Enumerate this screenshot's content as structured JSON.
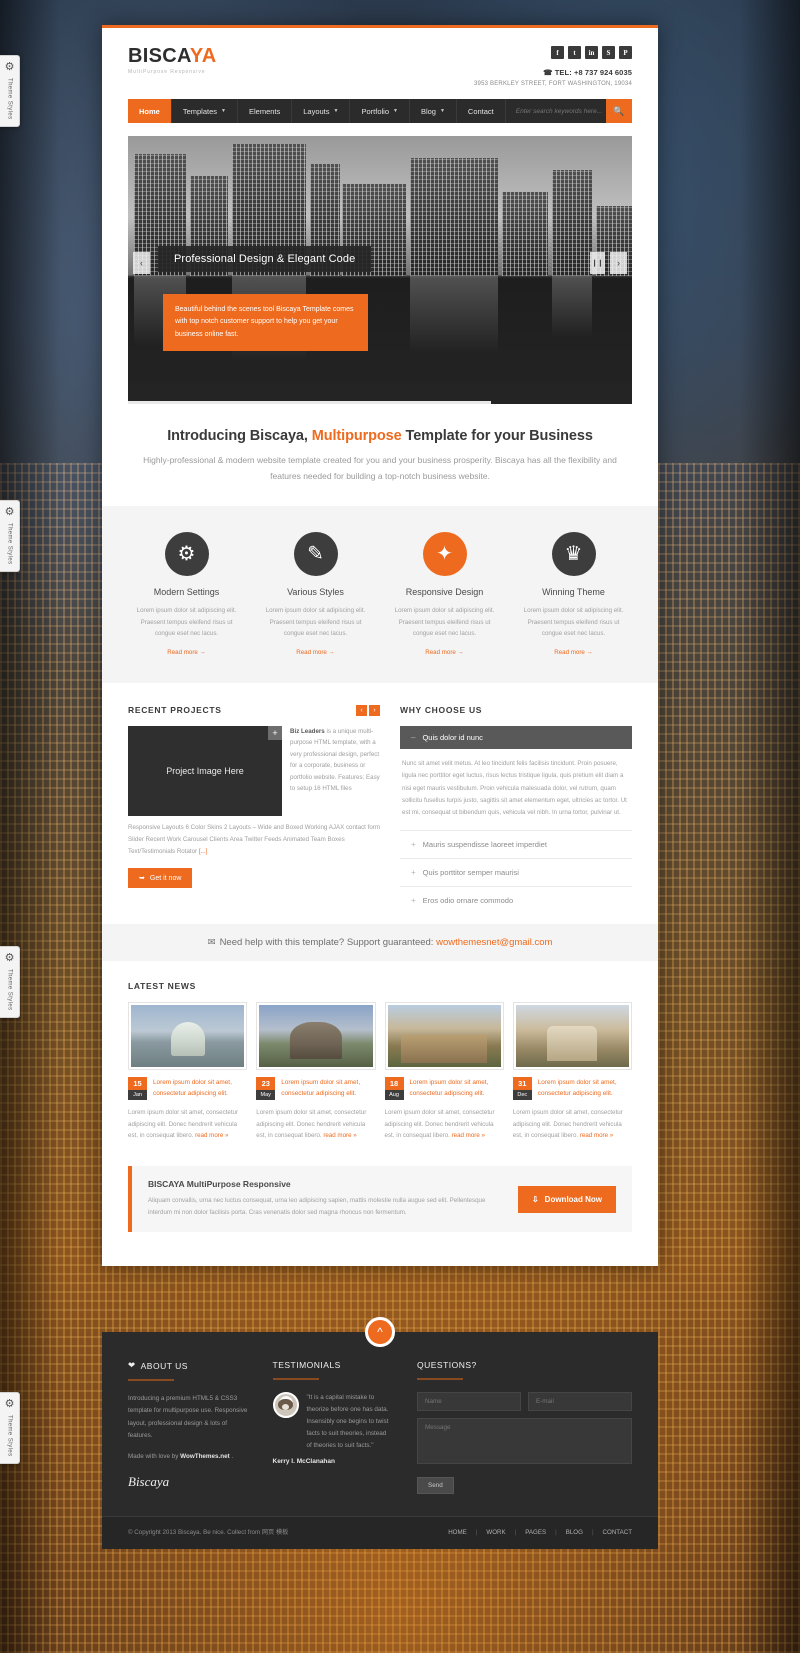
{
  "theme_tabs": [
    {
      "label": "Theme Styles",
      "icon": "gear-icon"
    },
    {
      "label": "Theme Styles",
      "icon": "gear-icon"
    },
    {
      "label": "Theme Styles",
      "icon": "gear-icon"
    },
    {
      "label": "Theme Styles",
      "icon": "gear-icon"
    }
  ],
  "header": {
    "logo_first": "BISCA",
    "logo_accent": "YA",
    "logo_sub": "MultiPurpose Responsive",
    "socials": [
      {
        "name": "facebook-icon",
        "glyph": "f"
      },
      {
        "name": "twitter-icon",
        "glyph": "t"
      },
      {
        "name": "linkedin-icon",
        "glyph": "in"
      },
      {
        "name": "skype-icon",
        "glyph": "S"
      },
      {
        "name": "pinterest-icon",
        "glyph": "P"
      }
    ],
    "phone": "TEL: +8 737 924 6035",
    "address": "3953 BERKLEY STREET, FORT WASHINGTON, 19034"
  },
  "nav": {
    "items": [
      {
        "label": "Home",
        "dropdown": false,
        "active": true
      },
      {
        "label": "Templates",
        "dropdown": true,
        "active": false
      },
      {
        "label": "Elements",
        "dropdown": false,
        "active": false
      },
      {
        "label": "Layouts",
        "dropdown": true,
        "active": false
      },
      {
        "label": "Portfolio",
        "dropdown": true,
        "active": false
      },
      {
        "label": "Blog",
        "dropdown": true,
        "active": false
      },
      {
        "label": "Contact",
        "dropdown": false,
        "active": false
      }
    ],
    "search_placeholder": "Enter search keywords here...",
    "search_icon": "search-icon"
  },
  "slider": {
    "caption": "Professional Design & Elegant Code",
    "box_text": "Beautiful behind the scenes tool Biscaya Template comes with top notch customer support to help you get your business online fast.",
    "prev": "‹",
    "next": "›",
    "pause": "❙❙"
  },
  "intro": {
    "title_before": "Introducing Biscaya, ",
    "title_highlight": "Multipurpose",
    "title_after": " Template for your Business",
    "paragraph": "Highly-professional & modern website template created for you and your business prosperity. Biscaya has all the flexibility and features needed for building a top-notch business website."
  },
  "services": [
    {
      "title": "Modern Settings",
      "icon": "gears-icon",
      "glyph": "⚙",
      "accent": false,
      "text": "Lorem ipsum dolor sit adipiscing elit. Praesent tempus eleifend risus ut congue eset nec lacus.",
      "more": "Read more →"
    },
    {
      "title": "Various Styles",
      "icon": "pencil-icon",
      "glyph": "✎",
      "accent": false,
      "text": "Lorem ipsum dolor sit adipiscing elit. Praesent tempus eleifend risus ut congue eset nec lacus.",
      "more": "Read more →"
    },
    {
      "title": "Responsive Design",
      "icon": "magic-wand-icon",
      "glyph": "✦",
      "accent": true,
      "text": "Lorem ipsum dolor sit adipiscing elit. Praesent tempus eleifend risus ut congue eset nec lacus.",
      "more": "Read more →"
    },
    {
      "title": "Winning Theme",
      "icon": "trophy-icon",
      "glyph": "♛",
      "accent": false,
      "text": "Lorem ipsum dolor sit adipiscing elit. Praesent tempus eleifend risus ut congue eset nec lacus.",
      "more": "Read more →"
    }
  ],
  "projects": {
    "title": "RECENT PROJECTS",
    "prev": "‹",
    "next": "›",
    "thumb_label": "Project Image Here",
    "plus_icon": "plus-icon",
    "lead_name": "Biz Leaders",
    "lead_text": " is a unique multi-purpose HTML template, with a very professional design, perfect for a corporate, business or portfolio website. Features: Easy to setup 16 HTML files",
    "desc": "Responsive Layouts 6 Color Skins 2 Layouts – Wide and Boxed Working AJAX contact form Slider Recent Work Carousel Clients Area Twitter Feeds Animated Team Boxes Text/Testimonials Rotator ",
    "desc_more": "[...]",
    "button": "Get it now",
    "button_icon": "arrow-icon"
  },
  "why_choose": {
    "title": "WHY CHOOSE US",
    "open_item": {
      "label": "Quis dolor id nunc",
      "sign": "–",
      "body": "Nunc sit amet velit metus. At leo tincidunt felis facilisis tincidunt. Proin posuere, ligula nec porttitor eget luctus, risus lectus tristique ligula, quis pretium elit diam a nisi eget mauris vestibulum. Proin vehicula malesuada dolor, vel rutrum, quam sollicitu fusellus turpis justo, sagittis sit amet elementum eget, ultricies ac tortor. Ut est mi, consequat ut bibendum quis, vehicula vel nibh. In urna tortor, pulvinar ut."
    },
    "items": [
      {
        "label": "Mauris suspendisse laoreet imperdiet",
        "sign": "+"
      },
      {
        "label": "Quis porttitor semper maurisi",
        "sign": "+"
      },
      {
        "label": "Eros odio ornare commodo",
        "sign": "+"
      }
    ]
  },
  "support": {
    "icon": "envelope-icon",
    "text": "Need help with this template? Support guaranteed: ",
    "email": "wowthemesnet@gmail.com"
  },
  "news": {
    "title": "LATEST NEWS",
    "items": [
      {
        "day": "15",
        "month": "Jan",
        "title": "Lorem ipsum dolor sit amet, consectetur adipiscing elit.",
        "body": "Lorem ipsum dolor sit amet, consectetur adipiscing elit. Donec hendrerit vehicula est, in consequat libero. ",
        "read_more": "read more »"
      },
      {
        "day": "23",
        "month": "May",
        "title": "Lorem ipsum dolor sit amet, consectetur adipiscing elit.",
        "body": "Lorem ipsum dolor sit amet, consectetur adipiscing elit. Donec hendrerit vehicula est, in consequat libero. ",
        "read_more": "read more »"
      },
      {
        "day": "18",
        "month": "Aug",
        "title": "Lorem ipsum dolor sit amet, consectetur adipiscing elit.",
        "body": "Lorem ipsum dolor sit amet, consectetur adipiscing elit. Donec hendrerit vehicula est, in consequat libero. ",
        "read_more": "read more »"
      },
      {
        "day": "31",
        "month": "Dec",
        "title": "Lorem ipsum dolor sit amet, consectetur adipiscing elit.",
        "body": "Lorem ipsum dolor sit amet, consectetur adipiscing elit. Donec hendrerit vehicula est, in consequat libero. ",
        "read_more": "read more »"
      }
    ]
  },
  "cta": {
    "title": "BISCAYA MultiPurpose Responsive",
    "text": "Aliquam convallis, urna nec luctus consequat, urna leo adipiscing sapien, mattis molestie nulla augue sed elit. Pellentesque interdum mi non dolor facilisis porta. Cras venenatis dolor sed magna rhoncus non fermentum.",
    "button": "Download Now",
    "button_icon": "download-icon"
  },
  "footer": {
    "to_top_icon": "chevron-up-icon",
    "about": {
      "heart_icon": "heart-icon",
      "title": "ABOUT US",
      "p1": "Introducing a premium HTML5 & CSS3 template for multipurpose use. Responsive layout, professional design & lots of features.",
      "p2_before": "Made with love by ",
      "p2_brand": "WowThemes.net",
      "p2_after": " .",
      "logo": "Biscaya"
    },
    "testimonials": {
      "title": "TESTIMONIALS",
      "avatar": "avatar",
      "quote": "\"It is a capital mistake to theorize before one has data. Insensibly one begins to twist facts to suit theories, instead of theories to suit facts.\"",
      "author": "Kerry I. McClanahan"
    },
    "questions": {
      "title": "QUESTIONS?",
      "name_placeholder": "Name",
      "email_placeholder": "E-mail",
      "message_placeholder": "Message",
      "send": "Send"
    },
    "copyright": "© Copyright 2013 Biscaya. Be nice. Collect from 网页 模板",
    "links": [
      "HOME",
      "WORK",
      "PAGES",
      "BLOG",
      "CONTACT"
    ]
  }
}
